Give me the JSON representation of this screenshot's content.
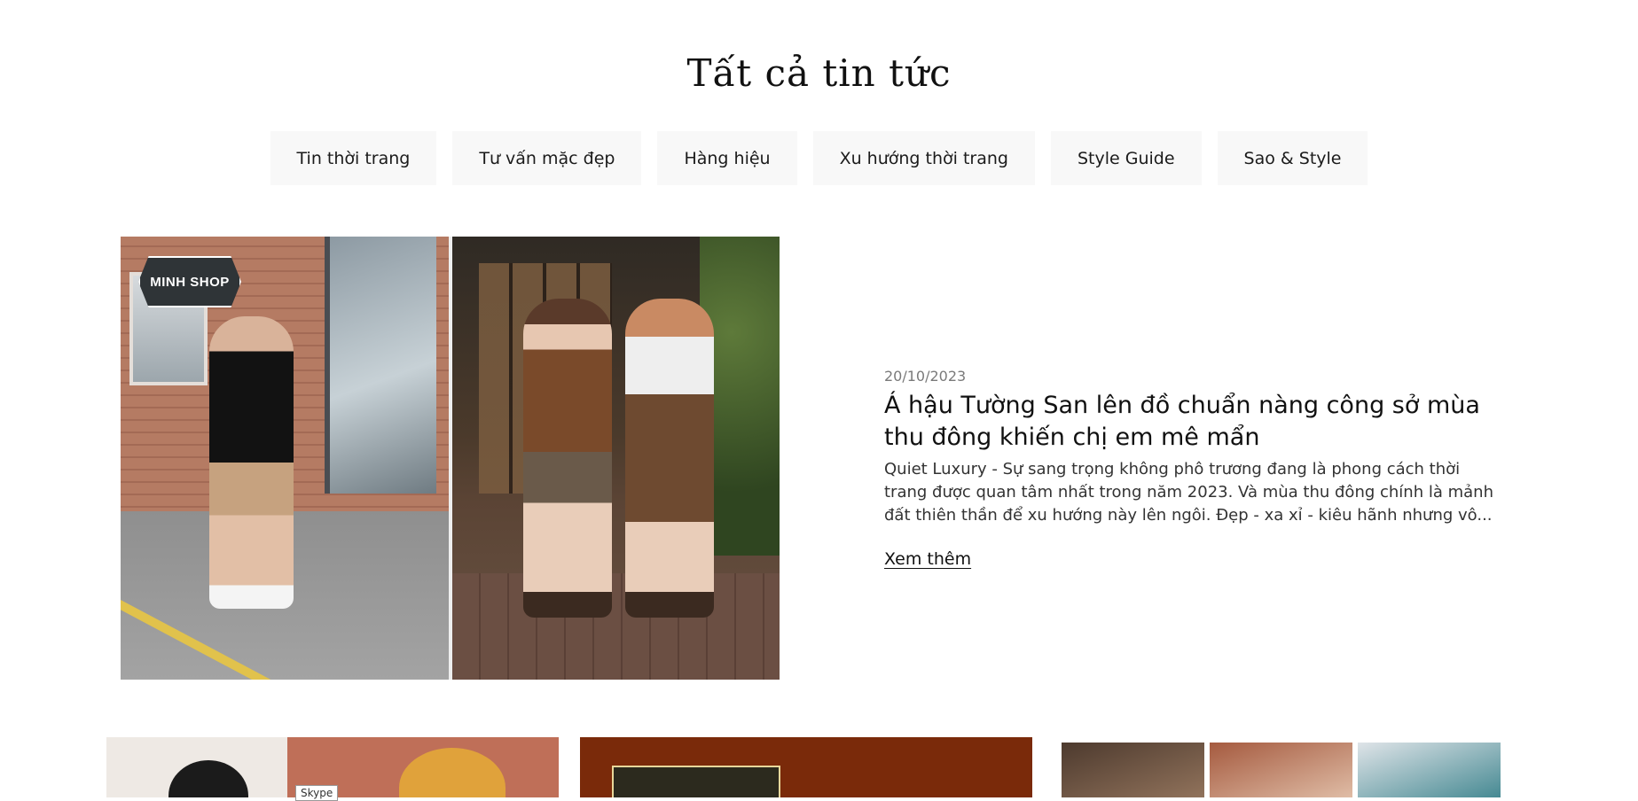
{
  "page": {
    "title": "Tất cả tin tức"
  },
  "tabs": [
    {
      "label": "Tin thời trang"
    },
    {
      "label": "Tư vấn mặc đẹp"
    },
    {
      "label": "Hàng hiệu"
    },
    {
      "label": "Xu hướng thời trang"
    },
    {
      "label": "Style Guide"
    },
    {
      "label": "Sao & Style"
    }
  ],
  "featured_post": {
    "image_logo_text": "MINH SHOP",
    "date": "20/10/2023",
    "title": "Á hậu Tường San lên đồ chuẩn nàng công sở mùa thu đông khiến chị em mê mẩn",
    "excerpt": "Quiet Luxury - Sự sang trọng không phô trương đang là phong cách thời trang được quan tâm nhất trong năm 2023. Và mùa thu đông chính là mảnh đất thiên thần để xu hướng này lên ngôi. Đẹp - xa xỉ - kiêu hãnh nhưng vô...",
    "read_more": "Xem thêm"
  },
  "overlays": {
    "skype_label": "Skype"
  },
  "colors": {
    "tab_background": "#f8f8f8",
    "text": "#111111",
    "date": "#7a7a7a"
  }
}
